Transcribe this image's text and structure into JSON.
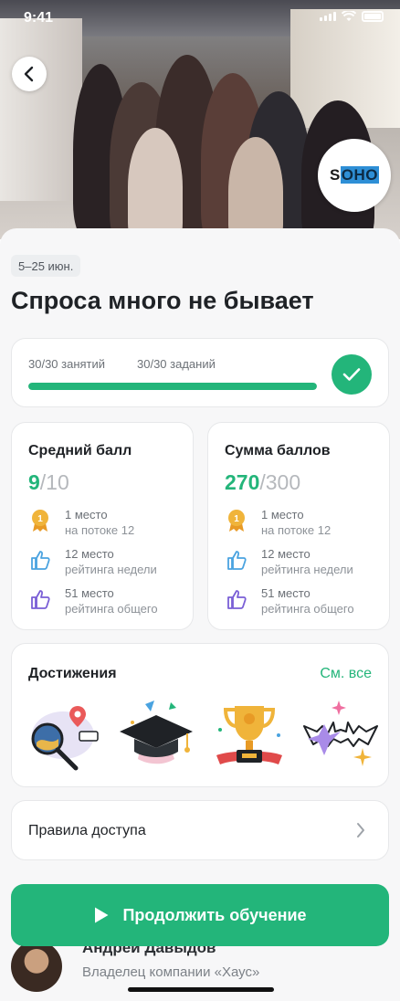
{
  "status": {
    "time": "9:41"
  },
  "hero": {
    "logo_text_a": "S",
    "logo_text_b": "OHO"
  },
  "course": {
    "date_range": "5–25 июн.",
    "title": "Спроса много не бывает"
  },
  "progress": {
    "lessons": "30/30 занятий",
    "tasks": "30/30 заданий",
    "fraction": 1.0
  },
  "stats": [
    {
      "title": "Средний балл",
      "value": "9",
      "max": "/10",
      "ranks": [
        {
          "place": "1 место",
          "scope": "на потоке 12",
          "icon": "medal-icon"
        },
        {
          "place": "12 место",
          "scope": "рейтинга недели",
          "icon": "thumbs-up-icon"
        },
        {
          "place": "51 место",
          "scope": "рейтинга общего",
          "icon": "thumbs-up-icon"
        }
      ]
    },
    {
      "title": "Сумма баллов",
      "value": "270",
      "max": "/300",
      "ranks": [
        {
          "place": "1 место",
          "scope": "на потоке 12",
          "icon": "medal-icon"
        },
        {
          "place": "12 место",
          "scope": "рейтинга недели",
          "icon": "thumbs-up-icon"
        },
        {
          "place": "51 место",
          "scope": "рейтинга общего",
          "icon": "thumbs-up-icon"
        }
      ]
    }
  ],
  "achievements": {
    "title": "Достижения",
    "see_all": "См. все",
    "items": [
      "magnifier-illustration",
      "graduation-cap-illustration",
      "trophy-illustration",
      "bat-sparkle-illustration"
    ]
  },
  "rules": {
    "label": "Правила доступа"
  },
  "author": {
    "name": "Андрей Давыдов",
    "role": "Владелец компании «Хаус»"
  },
  "cta": {
    "label": "Продолжить обучение"
  },
  "colors": {
    "accent": "#23b57a",
    "medal": "#f0b43a",
    "thumb_blue": "#4aa3e0",
    "thumb_purple": "#7a5fd6"
  }
}
